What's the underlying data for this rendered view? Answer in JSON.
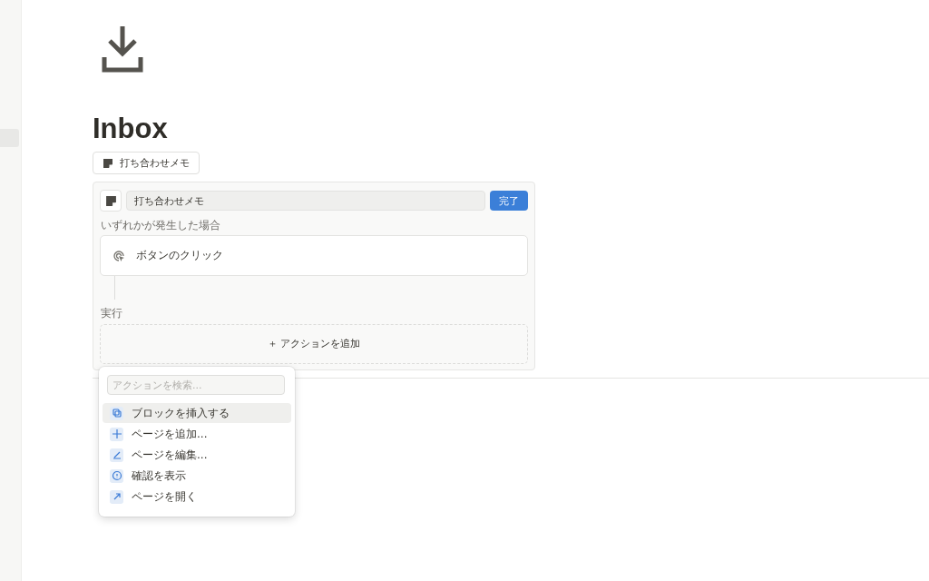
{
  "page": {
    "title": "Inbox"
  },
  "chip": {
    "label": "打ち合わせメモ"
  },
  "editor": {
    "name_value": "打ち合わせメモ",
    "done_label": "完了",
    "trigger_heading": "いずれかが発生した場合",
    "trigger_label": "ボタンのクリック",
    "action_heading": "実行",
    "add_action_label": "＋ アクションを追加"
  },
  "menu": {
    "search_placeholder": "アクションを検索...",
    "items": [
      {
        "label": "ブロックを挿入する",
        "kind": "copy",
        "selected": true
      },
      {
        "label": "ページを追加...",
        "kind": "plus",
        "selected": false
      },
      {
        "label": "ページを編集...",
        "kind": "edit",
        "selected": false
      },
      {
        "label": "確認を表示",
        "kind": "info",
        "selected": false
      },
      {
        "label": "ページを開く",
        "kind": "open",
        "selected": false
      }
    ]
  }
}
